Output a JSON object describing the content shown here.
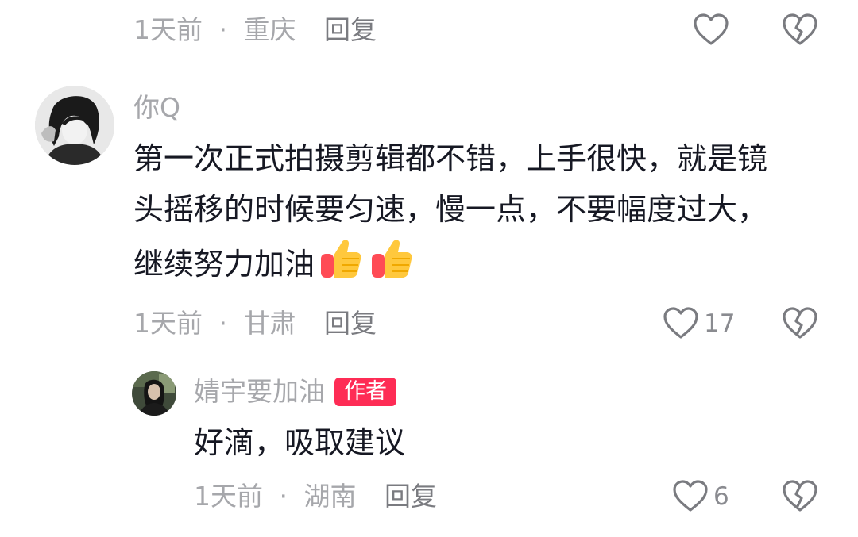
{
  "top_comment_footer": {
    "time": "1天前",
    "location": "重庆",
    "reply_label": "回复"
  },
  "comment": {
    "username": "你Q",
    "lines": [
      "第一次正式拍摄剪辑都不错，上手很快，就是镜",
      "头摇移的时候要匀速，慢一点，不要幅度过大，",
      "继续努力加油"
    ],
    "emoji": [
      "thumbs-up",
      "thumbs-up"
    ],
    "time": "1天前",
    "location": "甘肃",
    "reply_label": "回复",
    "like_count": "17"
  },
  "reply": {
    "username": "婧宇要加油",
    "badge": "作者",
    "text": "好滴，吸取建议",
    "time": "1天前",
    "location": "湖南",
    "reply_label": "回复",
    "like_count": "6"
  },
  "separator": "·",
  "colors": {
    "badge": "#fe2c55",
    "meta_text": "#a6a7ab",
    "body_text": "#161823"
  }
}
